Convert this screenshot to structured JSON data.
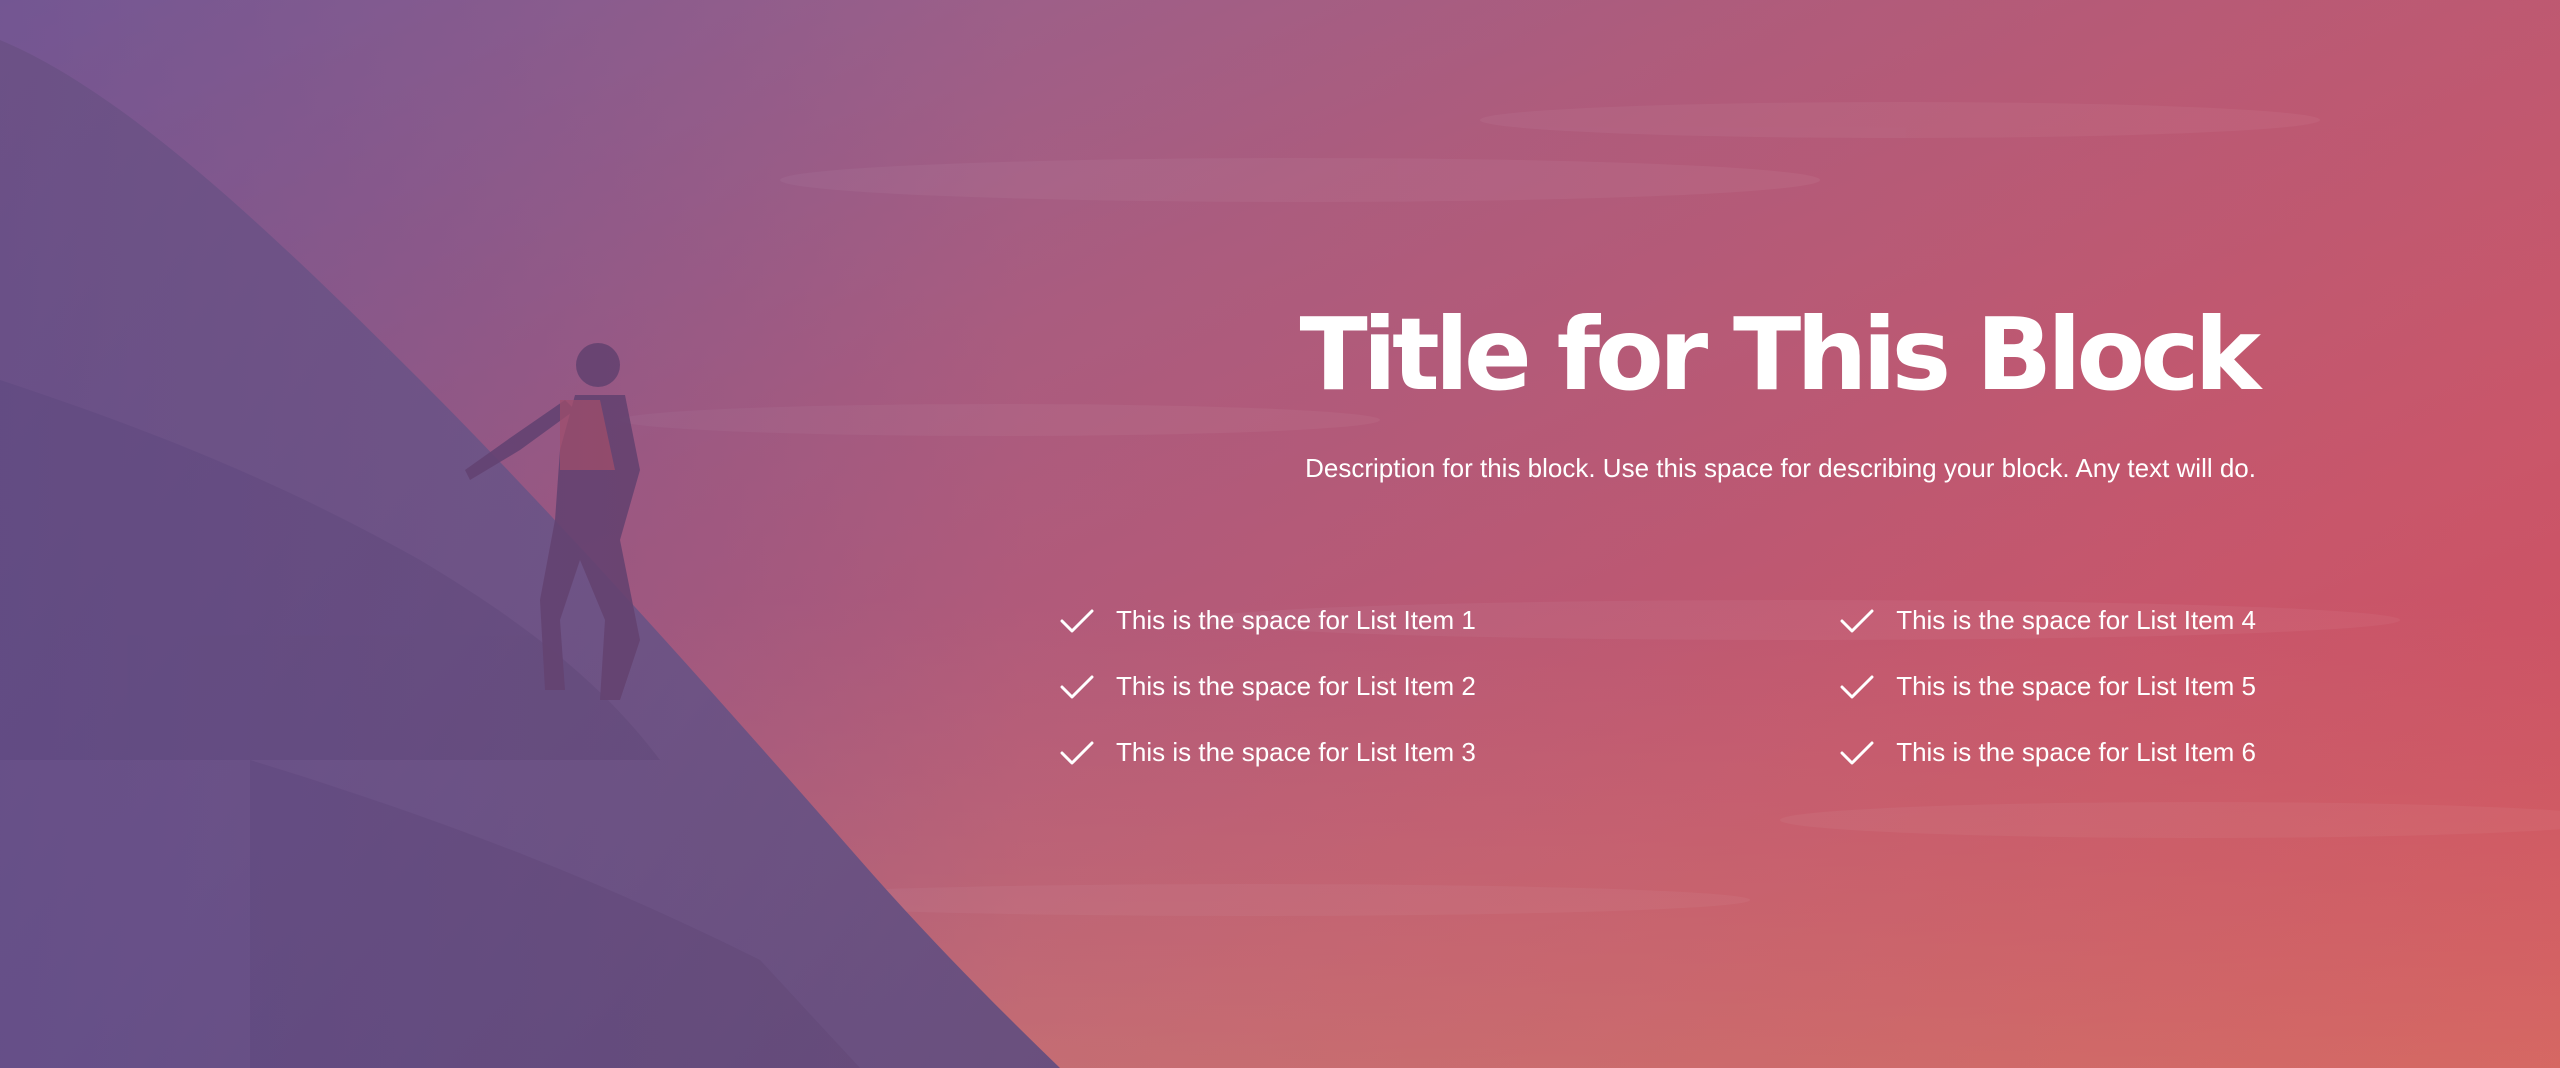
{
  "block": {
    "title": "Title for This Block",
    "description": "Description for this block. Use this space for describing your block. Any text will do."
  },
  "lists": {
    "left": [
      {
        "label": "This is the space for List Item 1",
        "icon": "check-icon"
      },
      {
        "label": "This is the space for List Item 2",
        "icon": "check-icon"
      },
      {
        "label": "This is the space for List Item 3",
        "icon": "check-icon"
      }
    ],
    "right": [
      {
        "label": "This is the space for List Item 4",
        "icon": "check-icon"
      },
      {
        "label": "This is the space for List Item 5",
        "icon": "check-icon"
      },
      {
        "label": "This is the space for List Item 6",
        "icon": "check-icon"
      }
    ]
  },
  "background": {
    "overlay_colors": [
      "#6a4c8c",
      "#b0607e",
      "#d4505e"
    ]
  }
}
